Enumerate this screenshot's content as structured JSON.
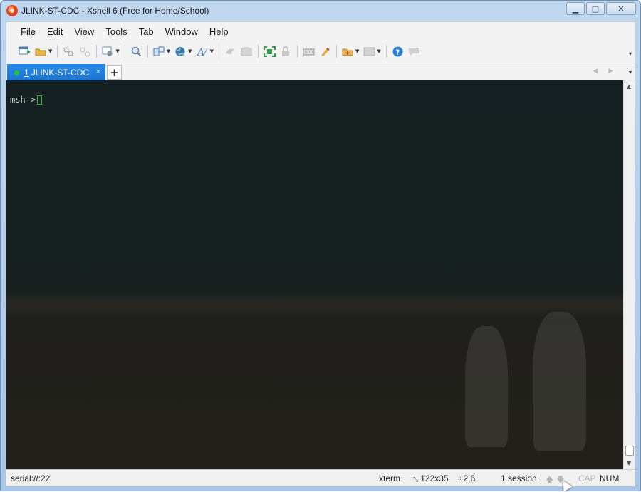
{
  "window": {
    "title": "JLINK-ST-CDC - Xshell 6 (Free for Home/School)",
    "controls": {
      "minimize": "▁",
      "maximize": "□",
      "close": "✕"
    }
  },
  "menubar": {
    "items": [
      "File",
      "Edit",
      "View",
      "Tools",
      "Tab",
      "Window",
      "Help"
    ]
  },
  "toolbar": {
    "icons": [
      "new-session-icon",
      "open-folder-icon",
      "connect-icon",
      "disconnect-icon",
      "properties-icon",
      "find-icon",
      "transfer-icon",
      "globe-icon",
      "font-icon",
      "xftp-icon",
      "xagent-icon",
      "fullscreen-icon",
      "lock-icon",
      "keyboard-icon",
      "highlight-icon",
      "new-folder-icon",
      "layout-icon",
      "help-icon",
      "chat-icon"
    ],
    "overflow": "▾"
  },
  "tabs": {
    "active": {
      "number": "1",
      "label": "JLINK-ST-CDC",
      "close": "×"
    },
    "add": "+",
    "nav": "◀ ▶",
    "menu": "▾"
  },
  "terminal": {
    "prompt": "msh >"
  },
  "scrollbar": {
    "up": "▲",
    "down": "▼"
  },
  "statusbar": {
    "connection": "serial://:22",
    "terminal_type": "xterm",
    "size": "122x35",
    "position": "2,6",
    "sessions": "1 session",
    "arrows": "🡅🡇",
    "cap": "CAP",
    "num": "NUM"
  },
  "colors": {
    "tab_active": "#1a73d0",
    "terminal_bg": "#142021",
    "cursor": "#2fbf3f"
  }
}
